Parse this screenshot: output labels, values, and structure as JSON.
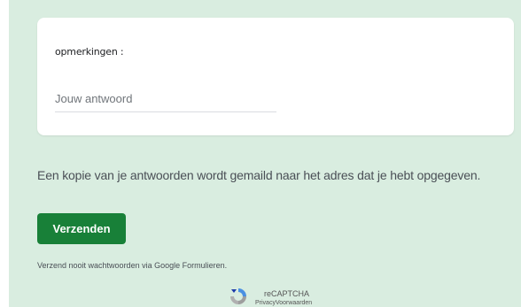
{
  "form": {
    "question_label": "opmerkingen :",
    "answer_placeholder": "Jouw antwoord",
    "answer_value": ""
  },
  "footer": {
    "copy_note": "Een kopie van je antwoorden wordt gemaild naar het adres dat je hebt opgegeven.",
    "submit_label": "Verzenden",
    "password_warning": "Verzend nooit wachtwoorden via Google Formulieren."
  },
  "recaptcha": {
    "title": "reCAPTCHA",
    "links": "PrivacyVoorwaarden",
    "icon": "recaptcha-icon"
  },
  "colors": {
    "background": "#d9ede0",
    "card": "#ffffff",
    "primary": "#188038"
  }
}
